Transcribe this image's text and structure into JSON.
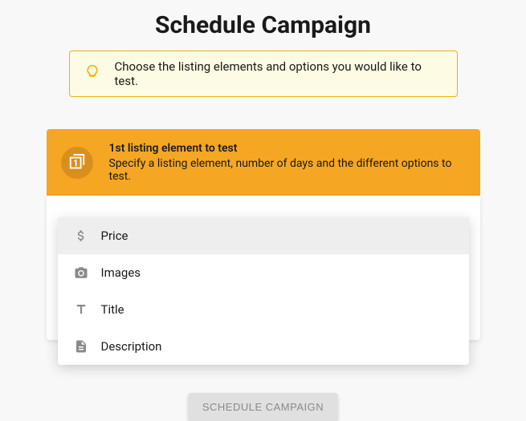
{
  "page": {
    "title": "Schedule Campaign"
  },
  "tip": {
    "text": "Choose the listing elements and options you would like to test."
  },
  "card": {
    "title": "1st listing element to test",
    "subtitle": "Specify a listing element, number of days and the different options to test."
  },
  "menu": {
    "items": [
      {
        "label": "Price"
      },
      {
        "label": "Images"
      },
      {
        "label": "Title"
      },
      {
        "label": "Description"
      }
    ]
  },
  "actions": {
    "schedule": "Schedule Campaign"
  }
}
